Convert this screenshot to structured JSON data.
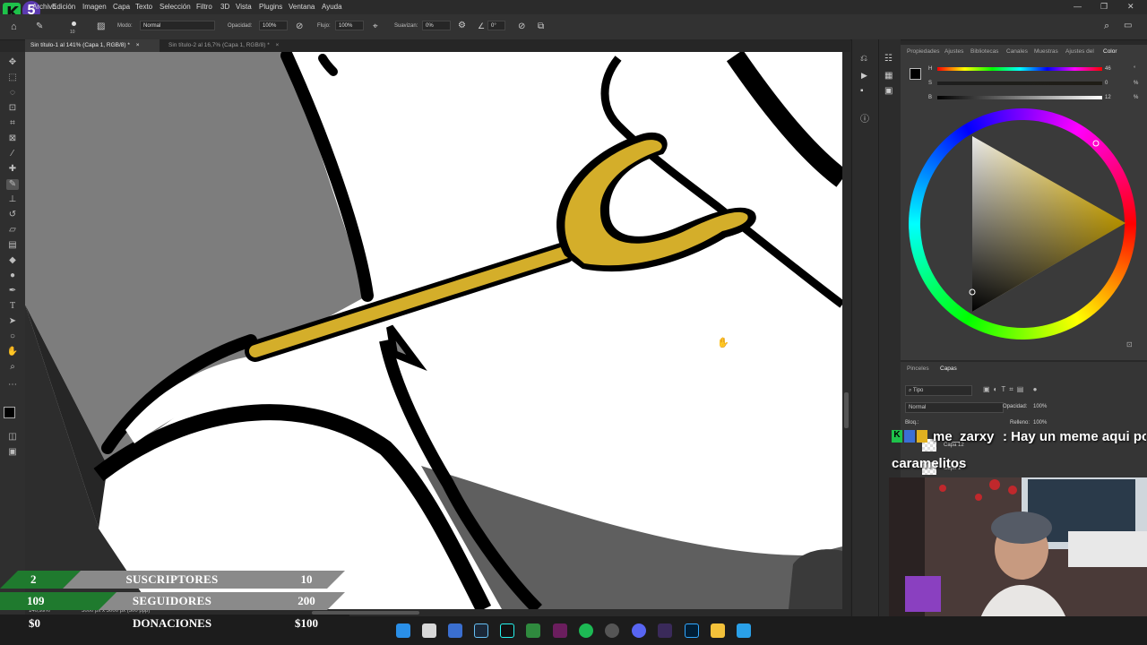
{
  "app": {
    "menu": [
      "Archivo",
      "Edición",
      "Imagen",
      "Capa",
      "Texto",
      "Selección",
      "Filtro",
      "3D",
      "Vista",
      "Plugins",
      "Ventana",
      "Ayuda"
    ],
    "logo_text": "5",
    "window_controls": [
      "—",
      "❐",
      "✕"
    ]
  },
  "options": {
    "brush_size": "10",
    "mode_label": "Modo:",
    "mode_value": "Normal",
    "opacity_label": "Opacidad:",
    "opacity_value": "100%",
    "flow_label": "Flujo:",
    "flow_value": "100%",
    "smooth_label": "Suavizan:",
    "smooth_value": "0%",
    "angle_value": "0°"
  },
  "tabs": [
    {
      "label": "Sin título-1 al 141% (Capa 1, RGB/8) *",
      "close": "×"
    },
    {
      "label": "Sin título-2 al 16,7% (Capa 1, RGB/8) *",
      "close": "×"
    }
  ],
  "status": {
    "zoom": "140,99%",
    "doc_size": "5000 px x 5000 px (300 ppp)"
  },
  "color_panel": {
    "tabs": [
      "Propiedades",
      "Ajustes",
      "Bibliotecas",
      "Canales",
      "Muestras",
      "Ajustes del",
      "Color"
    ],
    "sliders": [
      {
        "label": "H",
        "value": "46",
        "unit": "°"
      },
      {
        "label": "S",
        "value": "0",
        "unit": "%"
      },
      {
        "label": "B",
        "value": "12",
        "unit": "%"
      }
    ]
  },
  "layers_panel": {
    "tabs": [
      "Pinceles",
      "Capas"
    ],
    "filter_label": "Tipo",
    "blend_mode": "Normal",
    "opacity_label": "Opacidad:",
    "opacity_value": "100%",
    "lock_label": "Bloq.:",
    "fill_label": "Relleno:",
    "fill_value": "100%",
    "layers": [
      "Capa 12",
      "Capa 1"
    ]
  },
  "overlay": {
    "rows": [
      {
        "current": "2",
        "label": "SUSCRIPTORES",
        "goal": "10"
      },
      {
        "current": "109",
        "label": "SEGUIDORES",
        "goal": "200"
      },
      {
        "current": "$0",
        "label": "DONACIONES",
        "goal": "$100"
      }
    ]
  },
  "chat": {
    "username": "me_zarxy",
    "message": ": Hay un meme aqui por ejemplo",
    "message_line2": "caramelitos"
  },
  "colors": {
    "stroke_gold": "#d4ae2a",
    "overlay_green": "#1f7a2e",
    "overlay_gray": "#8a8a8a"
  }
}
